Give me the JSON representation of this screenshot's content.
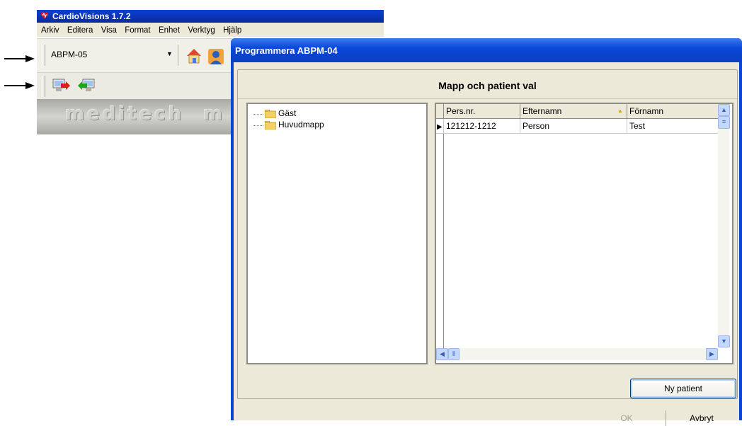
{
  "app": {
    "title": "CardioVisions 1.7.2",
    "menu": [
      "Arkiv",
      "Editera",
      "Visa",
      "Format",
      "Enhet",
      "Verktyg",
      "Hjälp"
    ],
    "device_combo": "ABPM-05",
    "logo_text": "meditech",
    "logo_text_2": "m"
  },
  "dialog": {
    "title": "Programmera ABPM-04",
    "header": "Mapp och patient val",
    "tree": [
      {
        "label": "Gäst"
      },
      {
        "label": "Huvudmapp"
      }
    ],
    "grid": {
      "columns": [
        "Pers.nr.",
        "Efternamn",
        "Förnamn"
      ],
      "sorted_column": "Efternamn",
      "rows": [
        {
          "pers_nr": "121212-1212",
          "efternamn": "Person",
          "fornamn": "Test"
        }
      ]
    },
    "buttons": {
      "new_patient": "Ny patient",
      "ok": "OK",
      "cancel": "Avbryt"
    }
  },
  "colors": {
    "titlebar": "#0a48d8",
    "dialog_bg": "#ece9d8"
  }
}
